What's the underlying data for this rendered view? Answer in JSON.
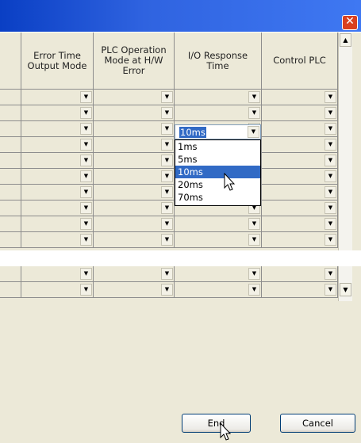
{
  "window": {
    "close_icon": "close-icon"
  },
  "grid": {
    "columns": [
      {
        "key": "error_time_output_mode",
        "label": "Error Time\nOutput Mode"
      },
      {
        "key": "plc_operation_mode_hw_error",
        "label": "PLC Operation\nMode at H/W\nError"
      },
      {
        "key": "io_response_time",
        "label": "I/O Response\nTime"
      },
      {
        "key": "control_plc",
        "label": "Control PLC"
      }
    ],
    "upper_row_count": 10,
    "lower_row_count": 2
  },
  "io_response_dropdown": {
    "current_value": "10ms",
    "options": [
      "1ms",
      "5ms",
      "10ms",
      "20ms",
      "70ms"
    ],
    "selected_option": "10ms"
  },
  "buttons": {
    "end_label": "End",
    "cancel_label": "Cancel"
  }
}
